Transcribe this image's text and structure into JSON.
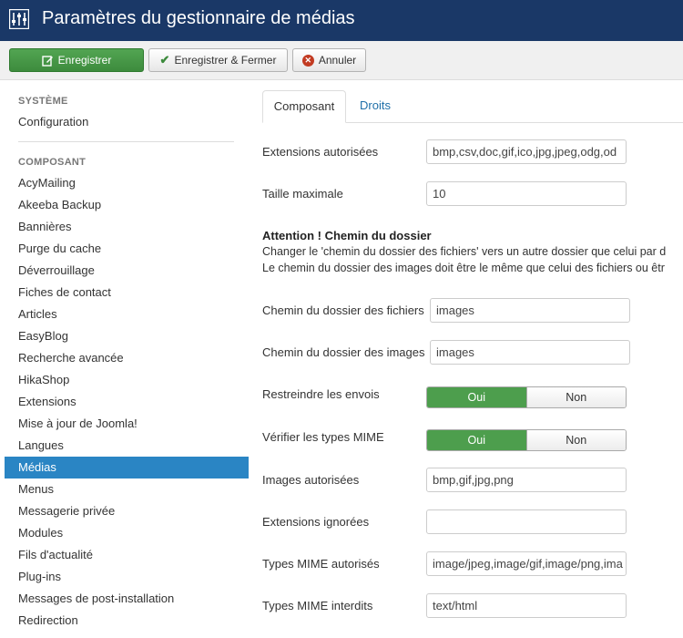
{
  "header": {
    "title": "Paramètres du gestionnaire de médias",
    "logo_icon": "settings-sliders-icon"
  },
  "toolbar": {
    "save_label": "Enregistrer",
    "save_close_label": "Enregistrer & Fermer",
    "cancel_label": "Annuler"
  },
  "sidebar": {
    "system_heading": "SYSTÈME",
    "system_items": [
      "Configuration"
    ],
    "component_heading": "COMPOSANT",
    "items": [
      "AcyMailing",
      "Akeeba Backup",
      "Bannières",
      "Purge du cache",
      "Déverrouillage",
      "Fiches de contact",
      "Articles",
      "EasyBlog",
      "Recherche avancée",
      "HikaShop",
      "Extensions",
      "Mise à jour de Joomla!",
      "Langues",
      "Médias",
      "Menus",
      "Messagerie privée",
      "Modules",
      "Fils d'actualité",
      "Plug-ins",
      "Messages de post-installation",
      "Redirection"
    ],
    "active_item": "Médias"
  },
  "tabs": [
    {
      "label": "Composant",
      "active": true
    },
    {
      "label": "Droits",
      "active": false
    }
  ],
  "form": {
    "extensions_label": "Extensions autorisées",
    "extensions_value": "bmp,csv,doc,gif,ico,jpg,jpeg,odg,od",
    "maxsize_label": "Taille maximale",
    "maxsize_value": "10",
    "notice_title": "Attention ! Chemin du dossier",
    "notice_line1": "Changer le 'chemin du dossier des fichiers' vers un autre dossier que celui par d",
    "notice_line2": "Le chemin du dossier des images doit être le même que celui des fichiers ou êtr",
    "file_path_label": "Chemin du dossier des fichiers",
    "file_path_value": "images",
    "image_path_label": "Chemin du dossier des images",
    "image_path_value": "images",
    "restrict_label": "Restreindre les envois",
    "check_mime_label": "Vérifier les types MIME",
    "yes_label": "Oui",
    "no_label": "Non",
    "images_label": "Images autorisées",
    "images_value": "bmp,gif,jpg,png",
    "ignore_label": "Extensions ignorées",
    "ignore_value": "",
    "mime_allowed_label": "Types MIME autorisés",
    "mime_allowed_value": "image/jpeg,image/gif,image/png,ima",
    "mime_denied_label": "Types MIME interdits",
    "mime_denied_value": "text/html"
  },
  "colors": {
    "header_bg": "#1a3867",
    "save_green": "#4d9e4d",
    "active_blue": "#2a85c4",
    "cancel_red": "#c23b22"
  }
}
